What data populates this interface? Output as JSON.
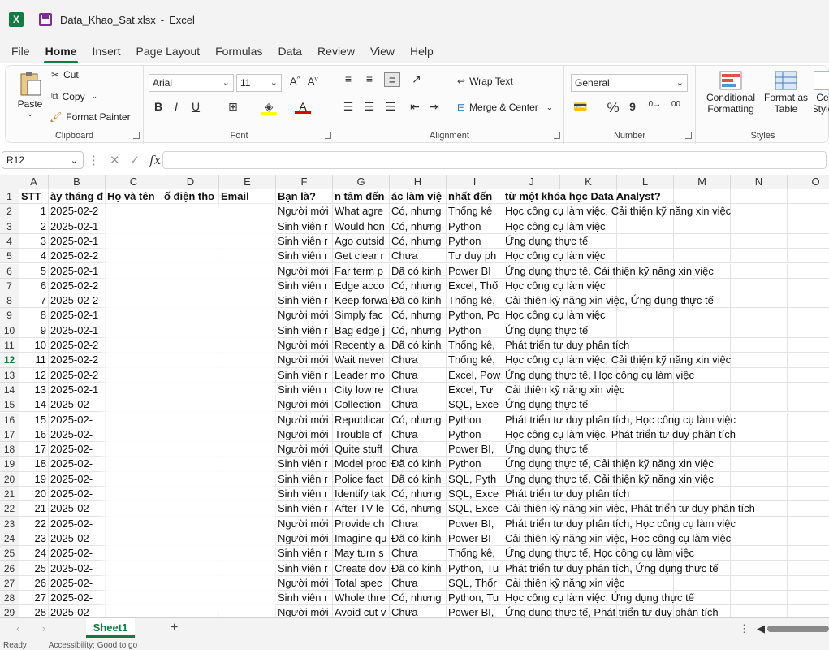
{
  "titlebar": {
    "app_icon": "X",
    "file_title": "Data_Khao_Sat.xlsx",
    "separator": "-",
    "app_name": "Excel"
  },
  "menu": [
    "File",
    "Home",
    "Insert",
    "Page Layout",
    "Formulas",
    "Data",
    "Review",
    "View",
    "Help"
  ],
  "ribbon": {
    "clipboard": {
      "paste": "Paste",
      "cut": "Cut",
      "copy": "Copy",
      "format_painter": "Format Painter",
      "label": "Clipboard"
    },
    "font": {
      "name": "Arial",
      "size": "11",
      "bold": "B",
      "italic": "I",
      "underline": "U",
      "label": "Font"
    },
    "alignment": {
      "wrap_text": "Wrap Text",
      "merge_center": "Merge & Center",
      "label": "Alignment"
    },
    "number": {
      "format": "General",
      "percent": "%",
      "comma": "9",
      "label": "Number"
    },
    "styles": {
      "conditional_1": "Conditional",
      "conditional_2": "Formatting",
      "format_as_1": "Format as",
      "format_as_2": "Table",
      "cell_1": "Ce",
      "cell_2": "Style",
      "label": "Styles"
    }
  },
  "formula_bar": {
    "name_box": "R12",
    "fx": "fx",
    "value": ""
  },
  "columns": [
    "A",
    "B",
    "C",
    "D",
    "E",
    "F",
    "G",
    "H",
    "I",
    "J",
    "K",
    "L",
    "M",
    "N",
    "O"
  ],
  "header_row": {
    "A": "STT",
    "B": "ày tháng đ",
    "C": "Họ và tên",
    "D": "ố điện tho",
    "E": "Email",
    "F": "Bạn là?",
    "G": "n tâm đến",
    "H": "ác làm việ",
    "I": "nhất đến",
    "J": "từ một khóa học Data Analyst?"
  },
  "rows": [
    {
      "n": "1",
      "b": "2025-02-2",
      "f": "Người mới",
      "g": "What agre",
      "h": "Có, nhưng",
      "i": "Thống kê",
      "j": "Học công cụ làm việc, Cải thiện kỹ năng xin việc"
    },
    {
      "n": "2",
      "b": "2025-02-1",
      "f": "Sinh viên r",
      "g": "Would hon",
      "h": "Có, nhưng",
      "i": "Python",
      "j": "Học công cụ làm việc"
    },
    {
      "n": "3",
      "b": "2025-02-1",
      "f": "Sinh viên r",
      "g": "Ago outsid",
      "h": "Có, nhưng",
      "i": "Python",
      "j": "Ứng dụng thực tế"
    },
    {
      "n": "4",
      "b": "2025-02-2",
      "f": "Sinh viên r",
      "g": "Get clear r",
      "h": "Chưa",
      "i": "Tư duy ph",
      "j": "Học công cụ làm việc"
    },
    {
      "n": "5",
      "b": "2025-02-1",
      "f": "Người mới",
      "g": "Far term p",
      "h": "Đã có kinh",
      "i": "Power BI",
      "j": "Ứng dụng thực tế, Cải thiện kỹ năng xin việc"
    },
    {
      "n": "6",
      "b": "2025-02-2",
      "f": "Sinh viên r",
      "g": "Edge acco",
      "h": "Có, nhưng",
      "i": "Excel, Thố",
      "j": "Học công cụ làm việc"
    },
    {
      "n": "7",
      "b": "2025-02-2",
      "f": "Sinh viên r",
      "g": "Keep forwa",
      "h": "Đã có kinh",
      "i": "Thống kê,",
      "j": "Cải thiện kỹ năng xin việc, Ứng dụng thực tế"
    },
    {
      "n": "8",
      "b": "2025-02-1",
      "f": "Người mới",
      "g": "Simply fac",
      "h": "Có, nhưng",
      "i": "Python, Po",
      "j": "Học công cụ làm việc"
    },
    {
      "n": "9",
      "b": "2025-02-1",
      "f": "Sinh viên r",
      "g": "Bag edge j",
      "h": "Có, nhưng",
      "i": "Python",
      "j": "Ứng dụng thực tế"
    },
    {
      "n": "10",
      "b": "2025-02-2",
      "f": "Người mới",
      "g": "Recently a",
      "h": "Đã có kinh",
      "i": "Thống kê,",
      "j": "Phát triển tư duy phân tích"
    },
    {
      "n": "11",
      "b": "2025-02-2",
      "f": "Người mới",
      "g": "Wait never",
      "h": "Chưa",
      "i": "Thống kê,",
      "j": "Học công cụ làm việc, Cải thiện kỹ năng xin việc"
    },
    {
      "n": "12",
      "b": "2025-02-2",
      "f": "Sinh viên r",
      "g": "Leader mo",
      "h": "Chưa",
      "i": "Excel, Pow",
      "j": "Ứng dụng thực tế, Học công cụ làm việc"
    },
    {
      "n": "13",
      "b": "2025-02-1",
      "f": "Sinh viên r",
      "g": "City low re",
      "h": "Chưa",
      "i": "Excel, Tư",
      "j": "Cải thiện kỹ năng xin việc"
    },
    {
      "n": "14",
      "b": "2025-02-",
      "f": "Người mới",
      "g": "Collection",
      "h": "Chưa",
      "i": "SQL, Exce",
      "j": "Ứng dụng thực tế"
    },
    {
      "n": "15",
      "b": "2025-02-",
      "f": "Người mới",
      "g": "Republicar",
      "h": "Có, nhưng",
      "i": "Python",
      "j": "Phát triển tư duy phân tích, Học công cụ làm việc"
    },
    {
      "n": "16",
      "b": "2025-02-",
      "f": "Người mới",
      "g": "Trouble of",
      "h": "Chưa",
      "i": "Python",
      "j": "Học công cụ làm việc, Phát triển tư duy phân tích"
    },
    {
      "n": "17",
      "b": "2025-02-",
      "f": "Người mới",
      "g": "Quite stuff",
      "h": "Chưa",
      "i": "Power BI,",
      "j": "Ứng dụng thực tế"
    },
    {
      "n": "18",
      "b": "2025-02-",
      "f": "Sinh viên r",
      "g": "Model prod",
      "h": "Đã có kinh",
      "i": "Python",
      "j": "Ứng dụng thực tế, Cải thiện kỹ năng xin việc"
    },
    {
      "n": "19",
      "b": "2025-02-",
      "f": "Sinh viên r",
      "g": "Police fact",
      "h": "Đã có kinh",
      "i": "SQL, Pyth",
      "j": "Ứng dụng thực tế, Cải thiện kỹ năng xin việc"
    },
    {
      "n": "20",
      "b": "2025-02-",
      "f": "Sinh viên r",
      "g": "Identify tak",
      "h": "Có, nhưng",
      "i": "SQL, Exce",
      "j": "Phát triển tư duy phân tích"
    },
    {
      "n": "21",
      "b": "2025-02-",
      "f": "Sinh viên r",
      "g": "After TV le",
      "h": "Có, nhưng",
      "i": "SQL, Exce",
      "j": "Cải thiện kỹ năng xin việc, Phát triển tư duy phân tích"
    },
    {
      "n": "22",
      "b": "2025-02-",
      "f": "Người mới",
      "g": "Provide ch",
      "h": "Chưa",
      "i": "Power BI,",
      "j": "Phát triển tư duy phân tích, Học công cụ làm việc"
    },
    {
      "n": "23",
      "b": "2025-02-",
      "f": "Người mới",
      "g": "Imagine qu",
      "h": "Đã có kinh",
      "i": "Power BI",
      "j": "Cải thiện kỹ năng xin việc, Học công cụ làm việc"
    },
    {
      "n": "24",
      "b": "2025-02-",
      "f": "Sinh viên r",
      "g": "May turn s",
      "h": "Chưa",
      "i": "Thống kê,",
      "j": "Ứng dụng thực tế, Học công cụ làm việc"
    },
    {
      "n": "25",
      "b": "2025-02-",
      "f": "Sinh viên r",
      "g": "Create dov",
      "h": "Đã có kinh",
      "i": "Python, Tu",
      "j": "Phát triển tư duy phân tích, Ứng dụng thực tế"
    },
    {
      "n": "26",
      "b": "2025-02-",
      "f": "Người mới",
      "g": "Total spec",
      "h": "Chưa",
      "i": "SQL, Thốr",
      "j": "Cải thiện kỹ năng xin việc"
    },
    {
      "n": "27",
      "b": "2025-02-",
      "f": "Sinh viên r",
      "g": "Whole thre",
      "h": "Có, nhưng",
      "i": "Python, Tu",
      "j": "Học công cụ làm việc, Ứng dụng thực tế"
    },
    {
      "n": "28",
      "b": "2025-02-",
      "f": "Người mới",
      "g": "Avoid cut v",
      "h": "Chưa",
      "i": "Power BI,",
      "j": "Ứng dụng thực tế, Phát triển tư duy phân tích"
    }
  ],
  "sheet_tabs": [
    "Sheet1"
  ],
  "status": {
    "ready": "Ready",
    "accessibility": "Accessibility: Good to go"
  },
  "selected_row": "12",
  "accent": "#107c41"
}
